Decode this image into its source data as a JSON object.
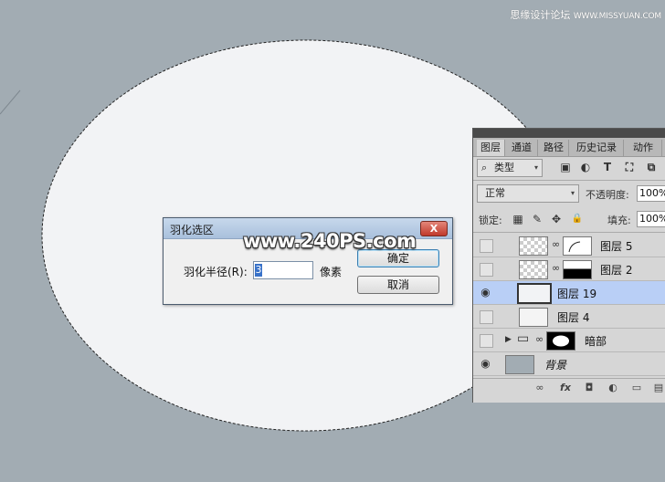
{
  "watermark": "思缘设计论坛",
  "watermark_url": "WWW.MISSYUAN.COM",
  "site_watermark": "www.240PS.com",
  "colors": {
    "canvas_bg": "#a2acb3",
    "selection_fill": "#f2f3f5",
    "selected_layer": "#b9cff6"
  },
  "dialog": {
    "title": "羽化选区",
    "close_glyph": "X",
    "radius_label": "羽化半径(R):",
    "radius_value": "3",
    "unit": "像素",
    "ok_label": "确定",
    "cancel_label": "取消"
  },
  "layers_panel": {
    "tabs": [
      "图层",
      "通道",
      "路径",
      "历史记录",
      "动作"
    ],
    "filter_kind": "类型",
    "search_glyph": "⌕",
    "filter_icons": [
      "image-filter-icon",
      "adjustment-filter-icon",
      "type-filter-icon",
      "shape-filter-icon",
      "smart-object-filter-icon"
    ],
    "filter_glyphs": [
      "▣",
      "◐",
      "T",
      "⛶",
      "⧉"
    ],
    "blend_mode": "正常",
    "opacity_label": "不透明度:",
    "opacity_value": "100%",
    "lock_label": "锁定:",
    "lock_glyphs": [
      "▦",
      "✎",
      "✥",
      "🔒"
    ],
    "fill_label": "填充:",
    "fill_value": "100%",
    "eye_glyph": "◉",
    "chain_glyph": "∞",
    "group_arrow": "▶",
    "folder_glyph": "▭",
    "layers": [
      {
        "name": "图层 5",
        "visible": false,
        "selected": false
      },
      {
        "name": "图层 2",
        "visible": false,
        "selected": false
      },
      {
        "name": "图层 19",
        "visible": true,
        "selected": true
      },
      {
        "name": "图层 4",
        "visible": false,
        "selected": false
      },
      {
        "name": "暗部",
        "visible": false,
        "selected": false
      },
      {
        "name": "背景",
        "visible": true,
        "selected": false
      }
    ],
    "footer_glyphs": [
      "∞",
      "fx",
      "◘",
      "◐",
      "▭",
      "▤"
    ]
  }
}
